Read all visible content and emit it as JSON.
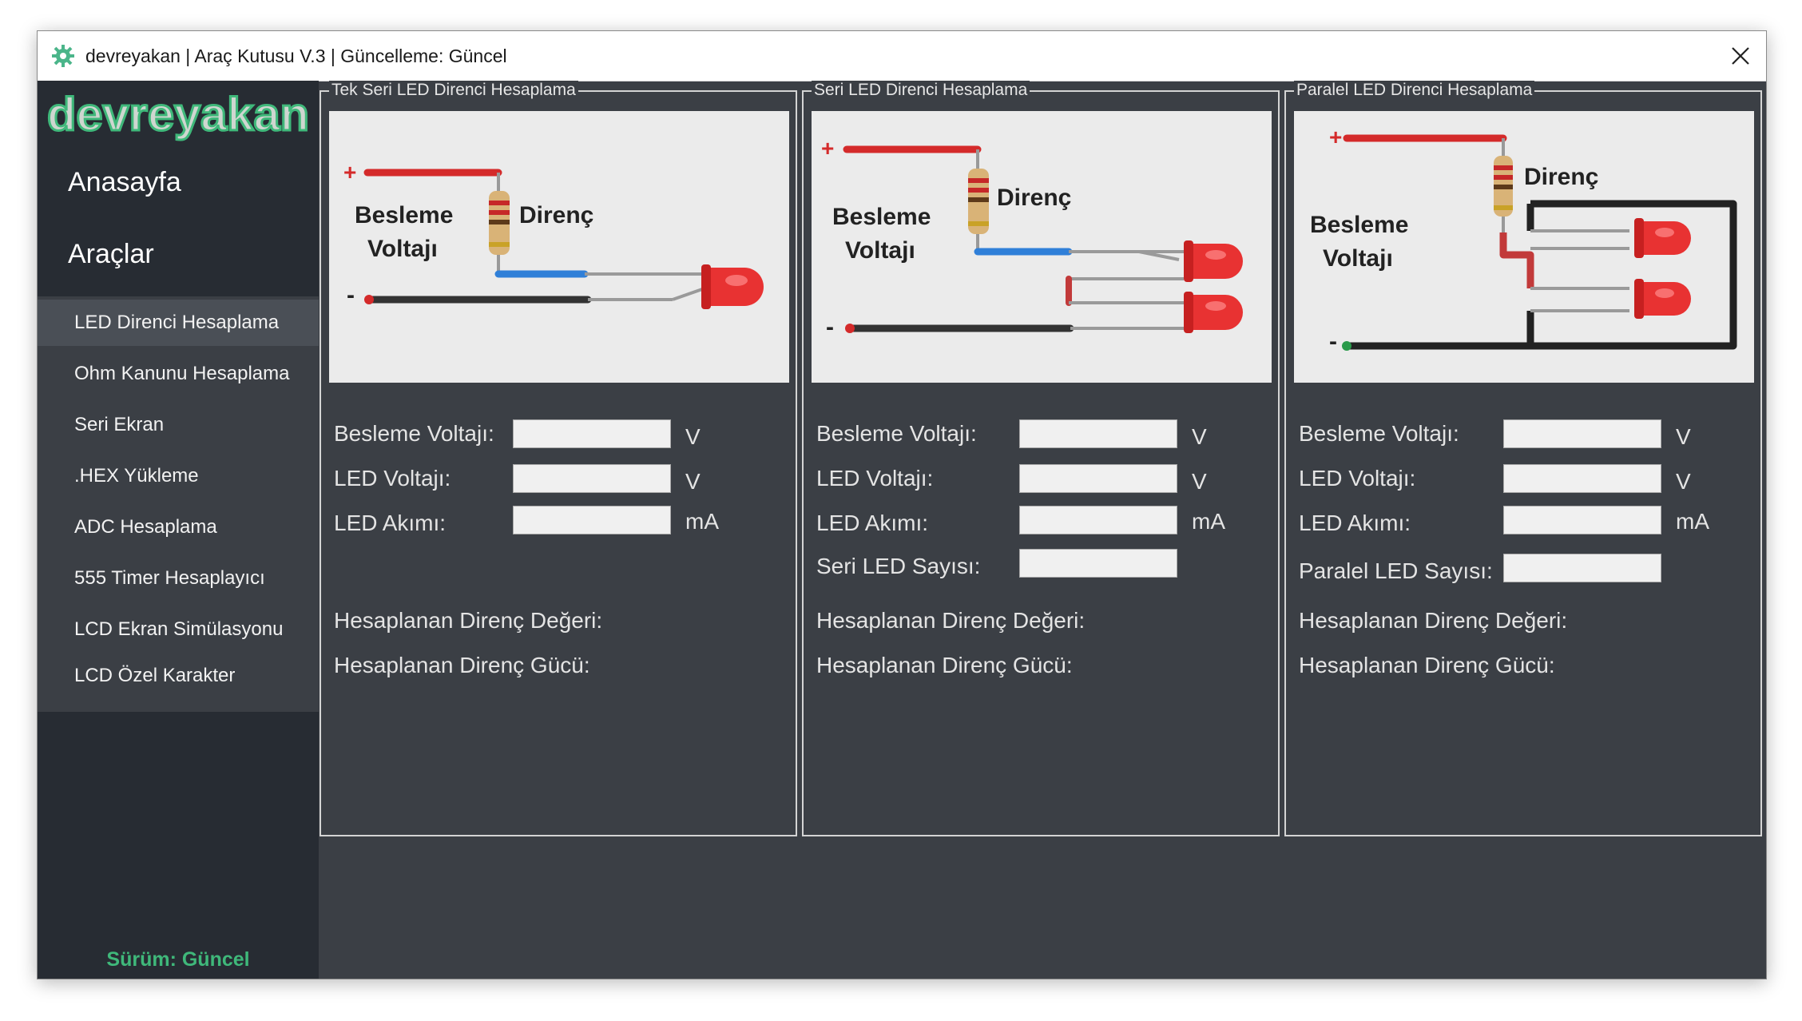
{
  "window": {
    "title": "devreyakan | Araç Kutusu V.3 | Güncelleme: Güncel",
    "app_icon": "gear-chip-icon",
    "close_icon": "close-icon"
  },
  "sidebar": {
    "logo_text": "devreyakan",
    "nav": [
      {
        "label": "Anasayfa"
      },
      {
        "label": "Araçlar"
      }
    ],
    "tools": [
      {
        "label": "LED Direnci Hesaplama",
        "active": true
      },
      {
        "label": "Ohm Kanunu Hesaplama"
      },
      {
        "label": "Seri Ekran"
      },
      {
        "label": ".HEX Yükleme"
      },
      {
        "label": "ADC Hesaplama"
      },
      {
        "label": "555 Timer Hesaplayıcı"
      },
      {
        "label": "LCD Ekran Simülasyonu"
      },
      {
        "label": "LCD Özel Karakter"
      }
    ],
    "version": "Sürüm: Güncel"
  },
  "colors": {
    "sidebar_bg": "#272c33",
    "content_bg": "#3b3f45",
    "version_green": "#3fb87a",
    "wire_red": "#d42a2a",
    "wire_blue": "#2f7fd8",
    "led_red": "#e83232"
  },
  "panels": [
    {
      "legend": "Tek Seri LED Direnci Hesaplama",
      "diagram": {
        "plus": "+",
        "minus": "-",
        "supply_line1": "Besleme",
        "supply_line2": "Voltajı",
        "resistor": "Direnç"
      },
      "fields": [
        {
          "label": "Besleme Voltajı:",
          "value": "",
          "unit": "V"
        },
        {
          "label": "LED Voltajı:",
          "value": "",
          "unit": "V"
        },
        {
          "label": "LED Akımı:",
          "value": "",
          "unit": "mA"
        }
      ],
      "result_resistance": "Hesaplanan Direnç Değeri:",
      "result_power": "Hesaplanan Direnç Gücü:"
    },
    {
      "legend": "Seri LED Direnci Hesaplama",
      "diagram": {
        "plus": "+",
        "minus": "-",
        "supply_line1": "Besleme",
        "supply_line2": "Voltajı",
        "resistor": "Direnç"
      },
      "fields": [
        {
          "label": "Besleme Voltajı:",
          "value": "",
          "unit": "V"
        },
        {
          "label": "LED Voltajı:",
          "value": "",
          "unit": "V"
        },
        {
          "label": "LED Akımı:",
          "value": "",
          "unit": "mA"
        },
        {
          "label": "Seri LED Sayısı:",
          "value": "",
          "unit": ""
        }
      ],
      "result_resistance": "Hesaplanan Direnç Değeri:",
      "result_power": "Hesaplanan Direnç Gücü:"
    },
    {
      "legend": "Paralel LED Direnci Hesaplama",
      "diagram": {
        "plus": "+",
        "minus": "-",
        "supply_line1": "Besleme",
        "supply_line2": "Voltajı",
        "resistor": "Direnç"
      },
      "fields": [
        {
          "label": "Besleme Voltajı:",
          "value": "",
          "unit": "V"
        },
        {
          "label": "LED Voltajı:",
          "value": "",
          "unit": "V"
        },
        {
          "label": "LED Akımı:",
          "value": "",
          "unit": "mA"
        },
        {
          "label": "Paralel LED Sayısı:",
          "value": "",
          "unit": ""
        }
      ],
      "result_resistance": "Hesaplanan Direnç Değeri:",
      "result_power": "Hesaplanan Direnç Gücü:"
    }
  ]
}
